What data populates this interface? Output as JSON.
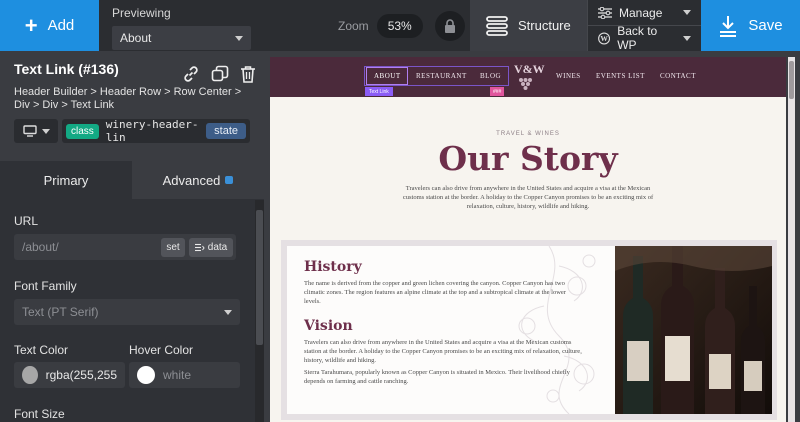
{
  "topbar": {
    "add_label": "Add",
    "previewing_label": "Previewing",
    "previewing_value": "About",
    "zoom_label": "Zoom",
    "zoom_value": "53%",
    "structure_label": "Structure",
    "manage_label": "Manage",
    "back_label": "Back to WP",
    "save_label": "Save"
  },
  "panel": {
    "element_title": "Text Link (#136)",
    "breadcrumb": "Header Builder > Header Row > Row Center > Div > Div > Text Link",
    "class_pill": "class",
    "class_name": "winery-header-lin",
    "state_label": "state",
    "tabs": [
      {
        "label": "Primary"
      },
      {
        "label": "Advanced"
      }
    ],
    "url_label": "URL",
    "url_placeholder": "/about/",
    "set_label": "set",
    "data_label": "data",
    "font_family_label": "Font Family",
    "font_family_value": "Text (PT Serif)",
    "text_color_label": "Text Color",
    "text_color_value": "rgba(255,255",
    "hover_color_label": "Hover Color",
    "hover_color_value": "white",
    "font_size_label": "Font Size"
  },
  "site": {
    "nav": [
      "ABOUT",
      "RESTAURANT",
      "BLOG",
      "WINES",
      "EVENTS LIST",
      "CONTACT"
    ],
    "logo": "V&W",
    "tag_text_link": "Text Link",
    "tag_small": "###",
    "eyebrow": "TRAVEL & WINES",
    "headline": "Our Story",
    "intro": "Travelers can also drive from anywhere in the United States and acquire a visa at the Mexican customs station at the border. A holiday to the Copper Canyon promises to be an exciting mix of relaxation, culture, history, wildlife and hiking.",
    "history_title": "History",
    "history_text": "The name is derived from the copper and green lichen covering the canyon. Copper Canyon has two climatic zones. The region features an alpine climate at the top and a subtropical climate at the lower levels.",
    "vision_title": "Vision",
    "vision_text": "Travelers can also drive from anywhere in the United States and acquire a visa at the Mexican customs station at the border. A holiday to the Copper Canyon promises to be an exciting mix of relaxation, culture, history, wildlife and hiking.",
    "vision_text2": "Sierra Tarahumara, popularly known as Copper Canyon is situated in Mexico. Their livelihood chiefly depends on farming and cattle ranching."
  },
  "colors": {
    "accent": "#1e8fe0",
    "nav_bg": "#4b2a3b",
    "headline": "#6e2f4b",
    "class_pill": "#13a984",
    "text_color_swatch": "#a7a7a7",
    "hover_color_swatch": "#ffffff"
  }
}
